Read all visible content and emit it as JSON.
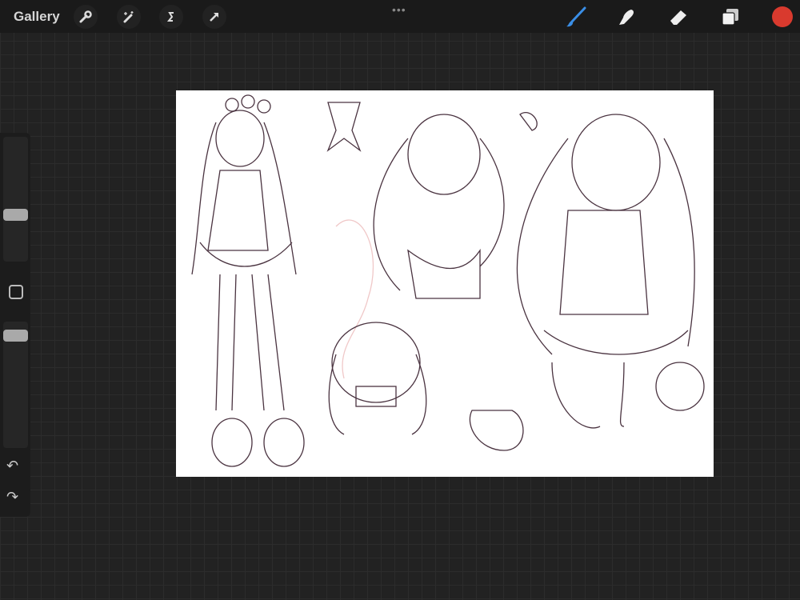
{
  "topbar": {
    "gallery_label": "Gallery",
    "left_tools": [
      "wrench-icon",
      "magic-wand-icon",
      "selection-icon",
      "transform-arrow-icon"
    ],
    "more_label": "•••",
    "right_tools": [
      "brush-icon",
      "smudge-icon",
      "eraser-icon",
      "layers-icon"
    ],
    "active_tool": "brush",
    "current_color": "#d93a2e",
    "accent_color": "#3a8ee6"
  },
  "sidebar": {
    "brush_size": 0.36,
    "opacity": 0.93,
    "undo_icon": "↶",
    "redo_icon": "↷"
  }
}
